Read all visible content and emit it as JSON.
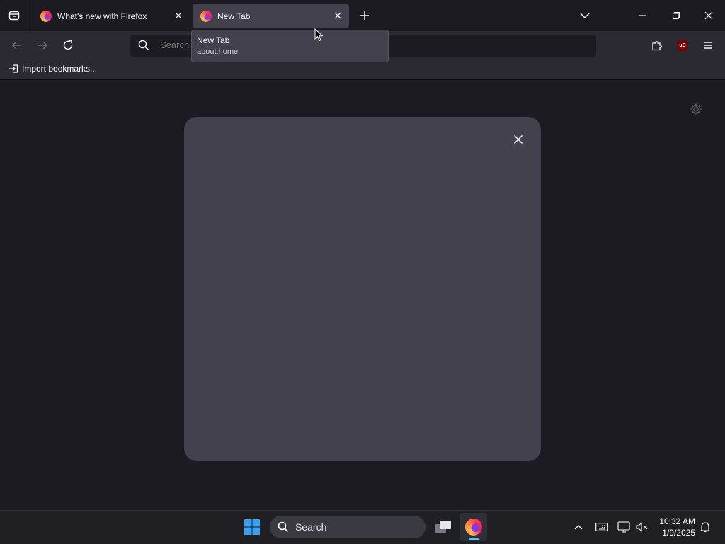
{
  "tabs": [
    {
      "title": "What's new with Firefox",
      "active": false
    },
    {
      "title": "New Tab",
      "active": true
    }
  ],
  "urlbar": {
    "placeholder": "Search or enter address"
  },
  "bookmarks": {
    "import_label": "Import bookmarks..."
  },
  "tooltip": {
    "title": "New Tab",
    "url": "about:home"
  },
  "taskbar": {
    "search_label": "Search",
    "time": "10:32 AM",
    "date": "1/9/2025"
  },
  "icons": {
    "firefox_extension_badge": "uD",
    "accent_colors": {
      "active_tab": "#42414d",
      "dialog": "#42414d",
      "taskbar_indicator": "#5cc3f0",
      "ublock": "#800000"
    }
  }
}
